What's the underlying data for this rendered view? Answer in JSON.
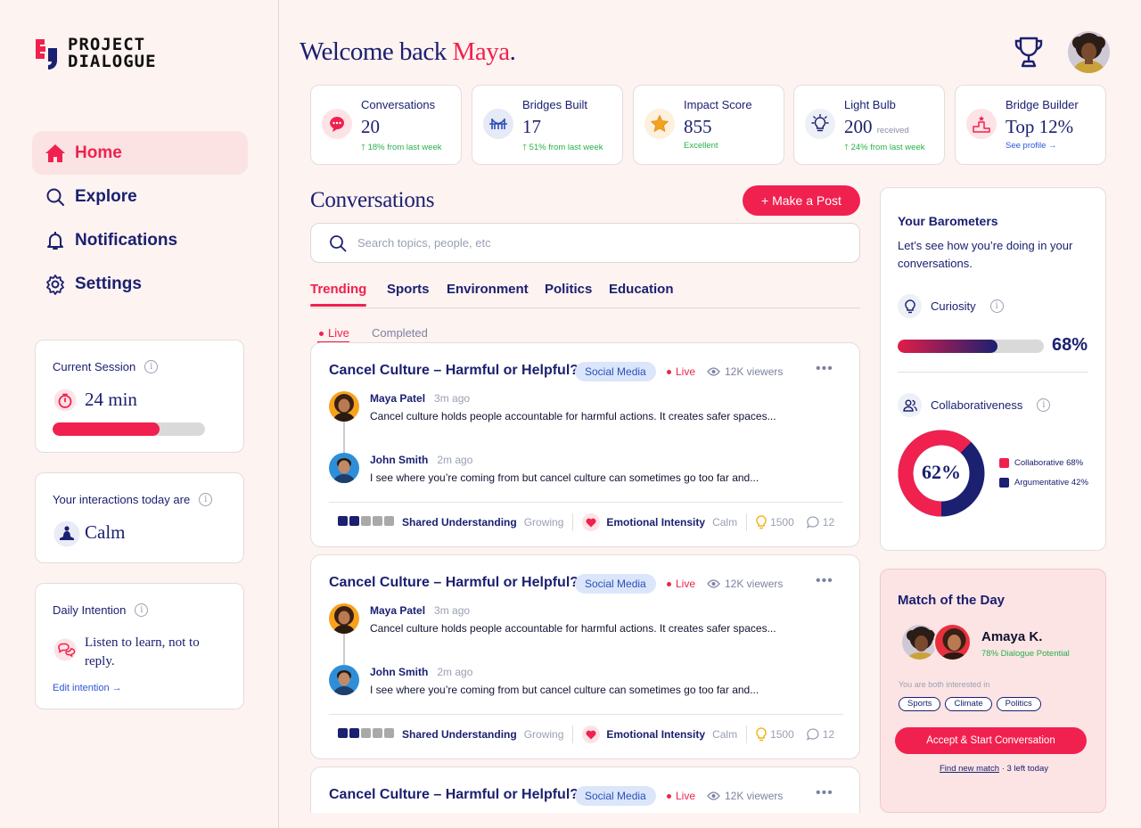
{
  "app": {
    "logo_line1": "PROJECT",
    "logo_line2": "DIALOGUE",
    "accent": "#f0214f",
    "navy": "#1b2070"
  },
  "nav": [
    {
      "label": "Home",
      "icon": "home-icon",
      "active": true
    },
    {
      "label": "Explore",
      "icon": "search-icon",
      "active": false
    },
    {
      "label": "Notifications",
      "icon": "bell-icon",
      "active": false
    },
    {
      "label": "Settings",
      "icon": "gear-icon",
      "active": false
    }
  ],
  "session": {
    "title": "Current Session",
    "value": "24 min",
    "progress": 0.7
  },
  "interactions": {
    "title": "Your interactions today are",
    "value": "Calm"
  },
  "intention": {
    "title": "Daily Intention",
    "text": "Listen to learn, not to reply.",
    "edit": "Edit intention →"
  },
  "header": {
    "welcome": "Welcome back ",
    "name": "Maya",
    "period": "."
  },
  "stats": [
    {
      "label": "Conversations",
      "value": "20",
      "sub": "18% from last week",
      "suffix": ""
    },
    {
      "label": "Bridges Built",
      "value": "17",
      "sub": "51% from last week",
      "suffix": ""
    },
    {
      "label": "Impact Score",
      "value": "855",
      "sub": "Excellent",
      "suffix": ""
    },
    {
      "label": "Light Bulb",
      "value": "200",
      "sub": "24% from last week",
      "suffix": "received"
    },
    {
      "label": "Bridge Builder",
      "value": "Top 12%",
      "sub": "See profile →",
      "suffix": ""
    }
  ],
  "main": {
    "title": "Conversations",
    "make_post": "+ Make a Post",
    "search_placeholder": "Search topics, people, etc",
    "tabs": [
      "Trending",
      "Sports",
      "Environment",
      "Politics",
      "Education"
    ],
    "subtabs": [
      "Live",
      "Completed"
    ]
  },
  "posts": [
    {
      "title": "Cancel Culture – Harmful or Helpful?",
      "tag": "Social Media",
      "live": "Live",
      "viewers": "12K viewers",
      "more": "•••",
      "user1": "Maya Patel",
      "time1": "3m ago",
      "msg1": "Cancel culture holds people accountable for harmful actions. It creates safer spaces...",
      "user2": "John Smith",
      "time2": "2m ago",
      "msg2": "I see where you’re coming from but cancel culture can sometimes go too far and...",
      "metric1": "Shared Understanding",
      "metric1_state": "Growing",
      "metric2": "Emotional Intensity",
      "metric2_state": "Calm",
      "bulbs": "1500",
      "comments": "12"
    },
    {
      "title": "Cancel Culture – Harmful or Helpful?",
      "tag": "Social Media",
      "live": "Live",
      "viewers": "12K viewers",
      "more": "•••",
      "user1": "Maya Patel",
      "time1": "3m ago",
      "msg1": "Cancel culture holds people accountable for harmful actions. It creates safer spaces...",
      "user2": "John Smith",
      "time2": "2m ago",
      "msg2": "I see where you’re coming from but cancel culture can sometimes go too far and...",
      "metric1": "Shared Understanding",
      "metric1_state": "Growing",
      "metric2": "Emotional Intensity",
      "metric2_state": "Calm",
      "bulbs": "1500",
      "comments": "12"
    },
    {
      "title": "Cancel Culture – Harmful or Helpful?",
      "tag": "Social Media",
      "live": "Live",
      "viewers": "12K viewers",
      "more": "•••"
    }
  ],
  "barometers": {
    "title": "Your Barometers",
    "desc": "Let’s see how you’re doing in your conversations.",
    "curiosity_label": "Curiosity",
    "curiosity_value": "68%",
    "curiosity_fraction": 0.68,
    "collab_label": "Collaborativeness",
    "donut_value": "62%",
    "legend1": "Collaborative 68%",
    "legend2": "Argumentative 42%"
  },
  "match": {
    "title": "Match of the Day",
    "name": "Amaya K.",
    "potential": "78% Dialogue Potential",
    "interest_label": "You are both interested in",
    "interests": [
      "Sports",
      "Climate",
      "Politics"
    ],
    "accept": "Accept & Start Conversation",
    "find": "Find new match",
    "left": " · 3 left today"
  }
}
